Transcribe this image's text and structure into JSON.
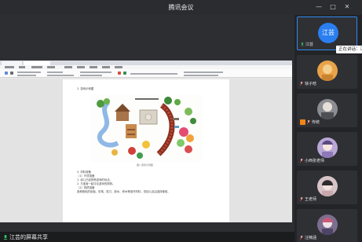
{
  "window": {
    "title": "腾讯会议"
  },
  "document": {
    "lines_top": [
      "2. 游戏示例图"
    ],
    "caption": "图1  游戏示例图",
    "lines_bottom": [
      "3. 材料准备",
      "（1）环境准备",
      "  1. 幼儿已经熟悉游戏的玩法。",
      "  2. 与宝宝一起讨论游戏的规则。",
      "（2）物质准备",
      "  各种颜色的纸板、彩笔、剪刀、胶水、积木等操作材料，供幼儿自由选择使用。"
    ]
  },
  "participants": [
    {
      "name": "江芸",
      "avatar_text": "江芸",
      "avatar_color": "#2a7ef0",
      "active": true
    },
    {
      "name": "徐子晗",
      "avatar_color": "#e8a349"
    },
    {
      "name": "传统",
      "avatar_color": "#8b8d92",
      "host": true
    },
    {
      "name": "小西张老师",
      "avatar_color": "#b9a7d6"
    },
    {
      "name": "王老师",
      "avatar_color": "#d7c4c8"
    },
    {
      "name": "汪楠涵",
      "avatar_color": "#7c6e8f"
    }
  ],
  "speaking": {
    "label": "正在讲话：江芸"
  },
  "share": {
    "label": "江芸的屏幕共享"
  }
}
